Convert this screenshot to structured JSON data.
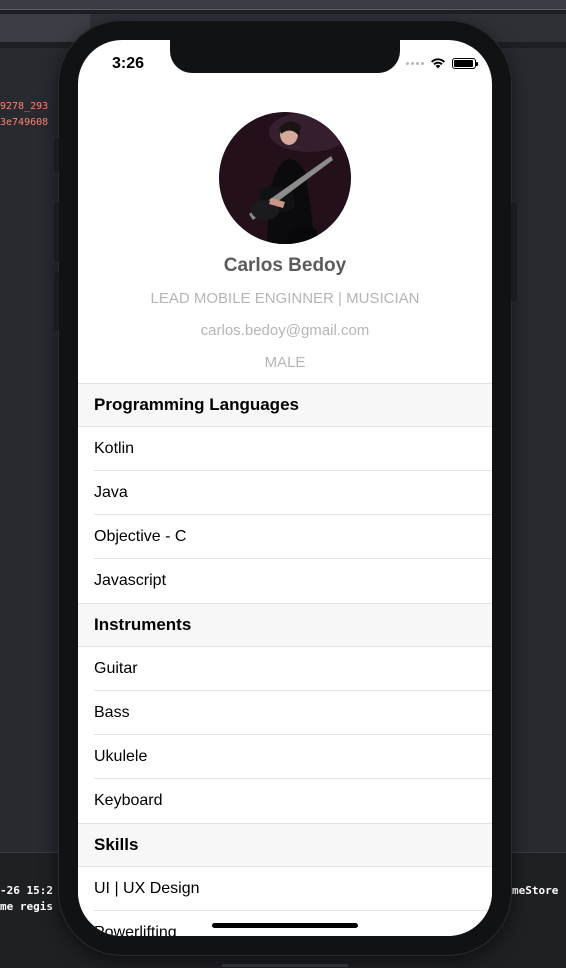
{
  "ide": {
    "code_lines": [
      "9278_293",
      "3e749608"
    ],
    "console_left": [
      "-26 15:2",
      "me regis"
    ],
    "console_right": [
      "meStore",
      ""
    ]
  },
  "status_bar": {
    "time": "3:26"
  },
  "profile": {
    "name": "Carlos Bedoy",
    "title": "LEAD MOBILE ENGINNER | MUSICIAN",
    "email": "carlos.bedoy@gmail.com",
    "gender": "MALE"
  },
  "sections": [
    {
      "title": "Programming Languages",
      "items": [
        "Kotlin",
        "Java",
        "Objective - C",
        "Javascript"
      ]
    },
    {
      "title": "Instruments",
      "items": [
        "Guitar",
        "Bass",
        "Ukulele",
        "Keyboard"
      ]
    },
    {
      "title": "Skills",
      "items": [
        "UI | UX Design",
        "Powerlifting"
      ]
    }
  ]
}
